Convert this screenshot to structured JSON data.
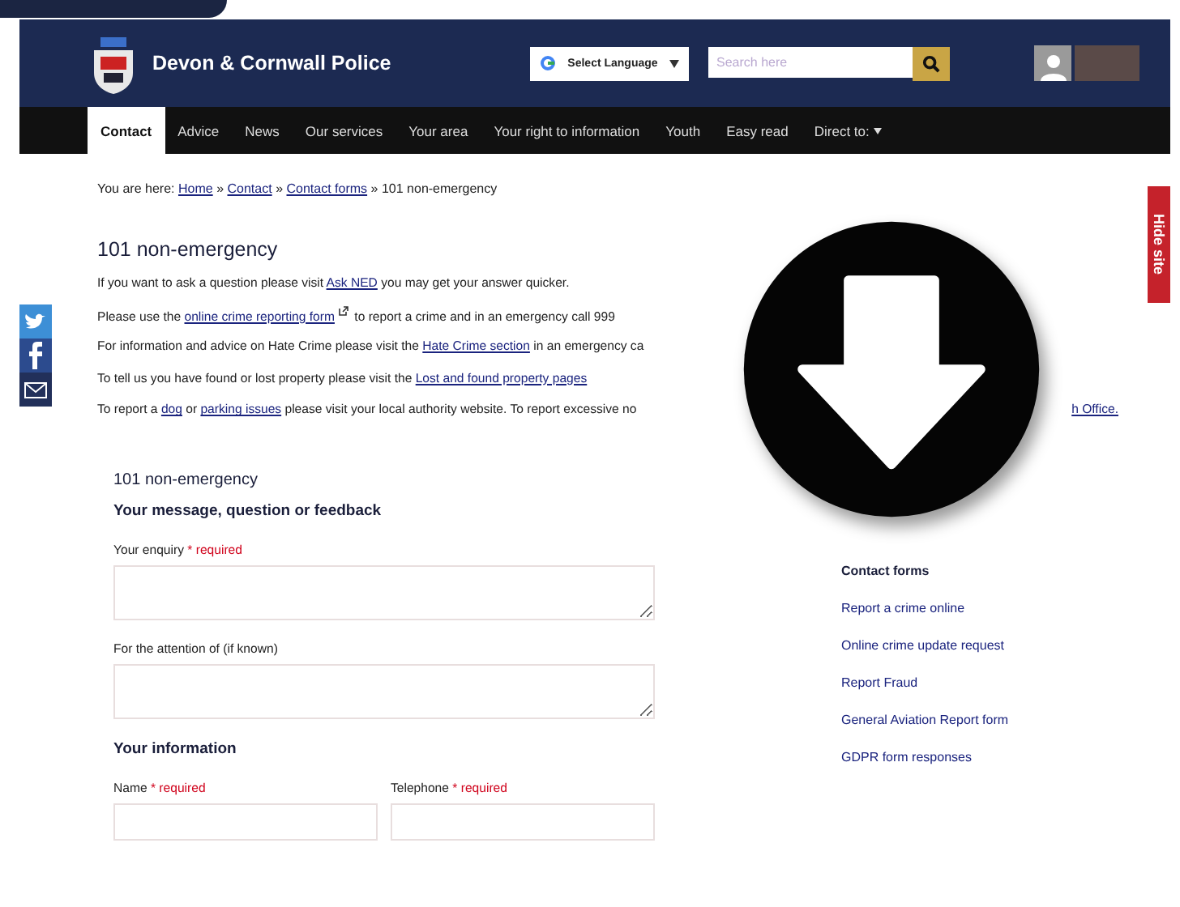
{
  "header": {
    "site_name": "Devon & Cornwall Police",
    "language_button": "Select Language",
    "search": {
      "placeholder": "Search here"
    }
  },
  "nav": [
    {
      "label": "Contact",
      "selected": true
    },
    {
      "label": "Advice",
      "selected": false
    },
    {
      "label": "News",
      "selected": false
    },
    {
      "label": "Our services",
      "selected": false
    },
    {
      "label": "Your area",
      "selected": false
    },
    {
      "label": "Your right to information",
      "selected": false
    },
    {
      "label": "Youth",
      "selected": false
    },
    {
      "label": "Easy read",
      "selected": false
    },
    {
      "label": "Direct to:",
      "selected": false,
      "dropdown": true
    }
  ],
  "hide_site": "Hide site",
  "breadcrumb": {
    "prefix": "You are here:",
    "separator": "»",
    "items": [
      {
        "text": "Home",
        "link": true
      },
      {
        "text": "Contact",
        "link": true
      },
      {
        "text": "Contact forms",
        "link": true
      },
      {
        "text": "101 non-emergency",
        "link": false
      }
    ]
  },
  "title": "101 non-emergency",
  "intro": [
    {
      "parts": [
        {
          "text": "If you want to ask a question please visit ",
          "link": false
        },
        {
          "text": "Ask NED",
          "link": true
        },
        {
          "text": " you may get your answer quicker.",
          "link": false
        }
      ]
    },
    {
      "parts": [
        {
          "text": "Please use the ",
          "link": false
        },
        {
          "text": "online crime reporting form",
          "link": true,
          "external": true
        },
        {
          "text": " to report a crime and in an emergency call 999",
          "link": false
        }
      ]
    },
    {
      "parts": [
        {
          "text": "For information and advice on Hate Crime please visit the ",
          "link": false
        },
        {
          "text": "Hate Crime section",
          "link": true
        },
        {
          "text": " in an emergency ca",
          "link": false
        }
      ]
    },
    {
      "parts": [
        {
          "text": "To tell us you have found or lost property please visit the ",
          "link": false
        },
        {
          "text": "Lost and found property pages",
          "link": true
        }
      ]
    },
    {
      "parts": [
        {
          "text": "To report a ",
          "link": false
        },
        {
          "text": "dog",
          "link": true
        },
        {
          "text": " or ",
          "link": false
        },
        {
          "text": "parking issues",
          "link": true
        },
        {
          "text": " please visit your local authority website. To report excessive no",
          "link": false
        }
      ],
      "tail": "h Office."
    }
  ],
  "form": {
    "title": "101 non-emergency",
    "sections": [
      {
        "heading": "Your message, question or feedback",
        "fields": [
          {
            "kind": "textarea",
            "label": "Your enquiry",
            "required": "* required"
          },
          {
            "kind": "textarea",
            "label": "For the attention of (if known)"
          }
        ]
      },
      {
        "heading": "Your information",
        "fields": [
          {
            "kind": "input",
            "label": "Name",
            "required": "* required"
          },
          {
            "kind": "input",
            "label": "Telephone",
            "required": "* required"
          }
        ]
      }
    ]
  },
  "sidebar": {
    "heading": "Contact forms",
    "items": [
      "Report a crime online",
      "Online crime update request",
      "Report Fraud",
      "General Aviation Report form",
      "GDPR form responses"
    ]
  }
}
